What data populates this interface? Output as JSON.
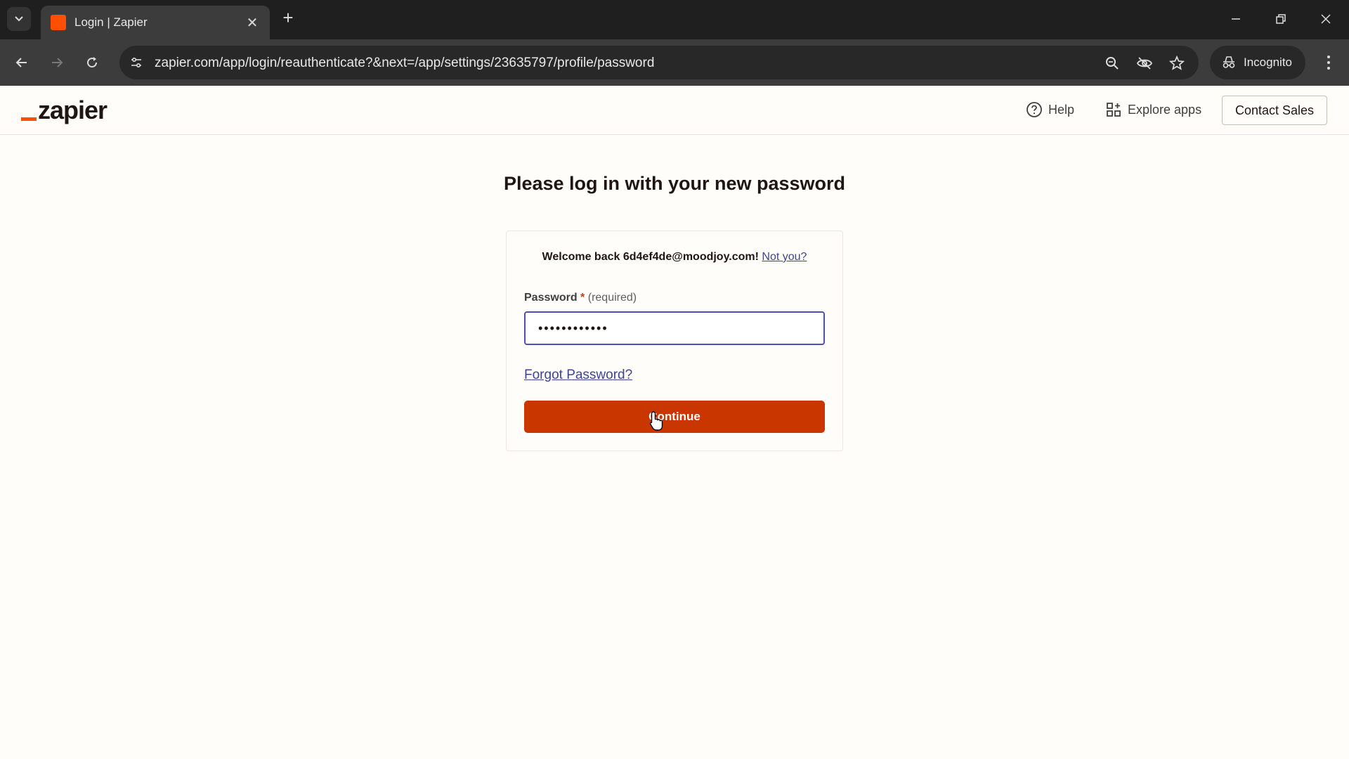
{
  "browser": {
    "tab_title": "Login | Zapier",
    "new_tab_symbol": "+",
    "tab_close_symbol": "✕",
    "url": "zapier.com/app/login/reauthenticate?&next=/app/settings/23635797/profile/password",
    "incognito_label": "Incognito"
  },
  "header": {
    "logo_text": "zapier",
    "help_label": "Help",
    "explore_label": "Explore apps",
    "contact_label": "Contact Sales"
  },
  "main": {
    "heading": "Please log in with your new password",
    "welcome_text": "Welcome back 6d4ef4de@moodjoy.com! ",
    "not_you_link": "Not you?",
    "password_label": "Password",
    "required_star": "*",
    "required_text": "(required)",
    "password_value": "••••••••••••",
    "forgot_link": "Forgot Password?",
    "continue_label": "Continue"
  },
  "colors": {
    "brand_orange": "#ff4f00",
    "button_bg": "#c93600",
    "link": "#3d4592",
    "input_focus_border": "#4d4fb3"
  }
}
